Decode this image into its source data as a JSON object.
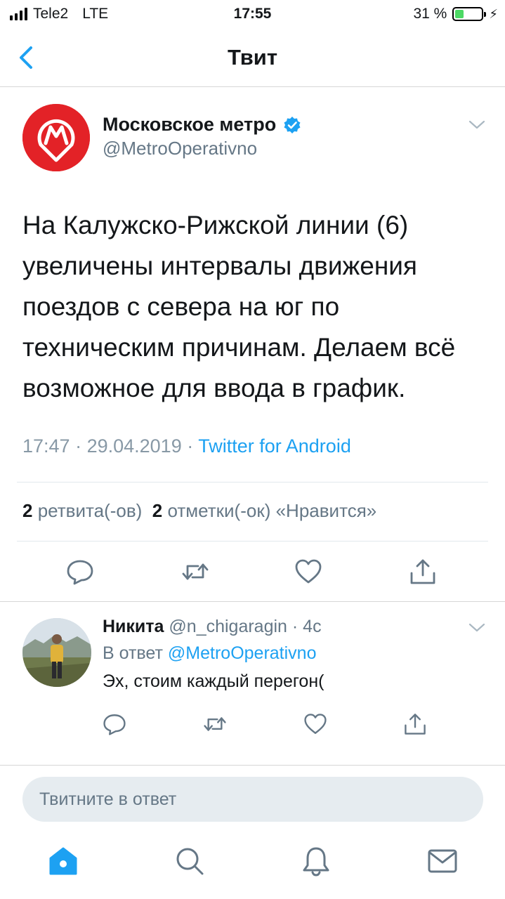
{
  "status_bar": {
    "carrier": "Tele2",
    "network": "LTE",
    "time": "17:55",
    "battery_percent": "31 %",
    "battery_level": 0.31,
    "battery_color": "#4cd964"
  },
  "nav": {
    "title": "Твит",
    "back_icon": "chevron-left-icon"
  },
  "tweet": {
    "author_name": "Московское метро",
    "author_handle": "@MetroOperativno",
    "verified": true,
    "text": "На Калужско-Рижской линии (6) увеличены интервалы движения поездов с севера на юг по техническим причинам. Делаем всё возможное для ввода в график.",
    "time": "17:47",
    "separator": " · ",
    "date": "29.04.2019",
    "source": "Twitter for Android",
    "retweets_count": "2",
    "retweets_label": "ретвита(-ов)",
    "likes_count": "2",
    "likes_label": "отметки(-ок) «Нравится»"
  },
  "reply": {
    "author_name": "Никита",
    "author_handle": "@n_chigaragin",
    "time_ago": "4с",
    "reply_to_label": "В ответ",
    "reply_to_handle": "@MetroOperativno",
    "text": "Эх, стоим каждый перегон("
  },
  "compose": {
    "placeholder": "Твитните в ответ"
  },
  "tabs": [
    {
      "icon": "home-icon",
      "active": true
    },
    {
      "icon": "search-icon",
      "active": false
    },
    {
      "icon": "bell-icon",
      "active": false
    },
    {
      "icon": "mail-icon",
      "active": false
    }
  ],
  "colors": {
    "accent": "#1da1f2",
    "metro_red": "#e32227",
    "muted": "#657786",
    "icon_gray": "#657786"
  }
}
